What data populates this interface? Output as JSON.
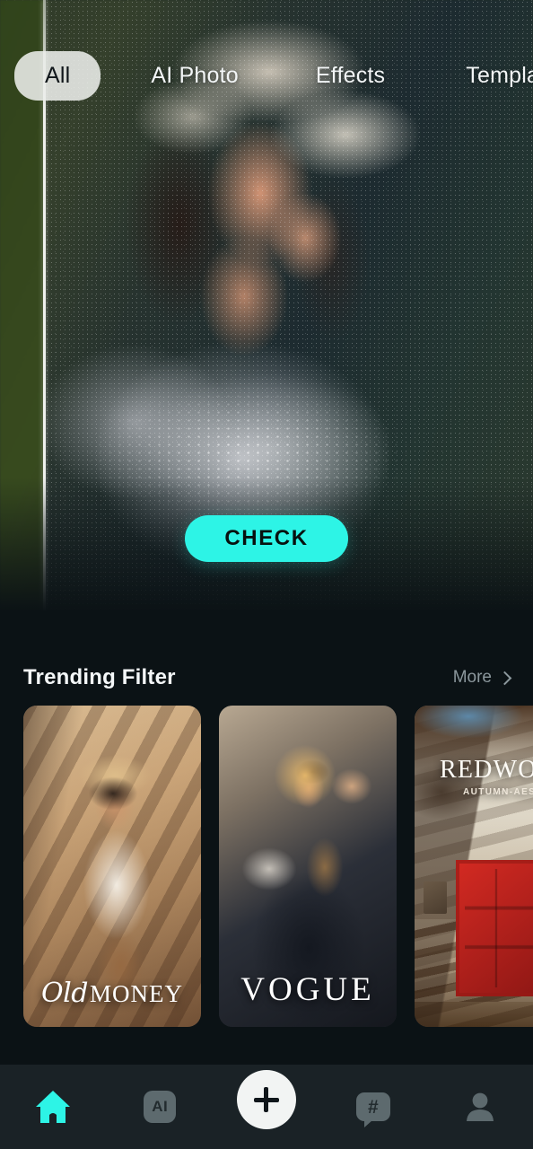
{
  "theme": {
    "background": "#0b1215",
    "nav_background": "#1a2226",
    "accent_cyan": "#2df4e6",
    "muted_text": "#8b979c",
    "icon_gray": "#5d6a6e"
  },
  "hero": {
    "alt": "Woman with lace bonnet and orange lipstick, before/after filter comparison slider",
    "check_button_label": "CHECK",
    "slider_name": "before-after-slider"
  },
  "tabs": [
    {
      "label": "All",
      "active": true
    },
    {
      "label": "AI Photo",
      "active": false
    },
    {
      "label": "Effects",
      "active": false
    },
    {
      "label": "Templates",
      "active": false
    }
  ],
  "trending": {
    "title": "Trending Filter",
    "more_label": "More",
    "cards": [
      {
        "title_script": "Old",
        "title_serif": "MONEY",
        "alt": "Woman in white blazer and straw hat at a cafe, warm sepia tone"
      },
      {
        "title": "VOGUE",
        "alt": "Blonde curly-haired woman in sunglasses holding a Vogue magazine"
      },
      {
        "title": "REDWOOD",
        "subtitle": "AUTUMN-AESTHETIC",
        "alt": "Red door on a cream stucco wall with autumn branches"
      }
    ]
  },
  "bottom_nav": [
    {
      "icon": "home-icon",
      "active": true
    },
    {
      "icon": "ai-icon",
      "label": "AI",
      "active": false
    },
    {
      "icon": "plus-icon",
      "active": false
    },
    {
      "icon": "hashtag-bubble-icon",
      "label": "#",
      "active": false
    },
    {
      "icon": "profile-icon",
      "active": false
    }
  ]
}
